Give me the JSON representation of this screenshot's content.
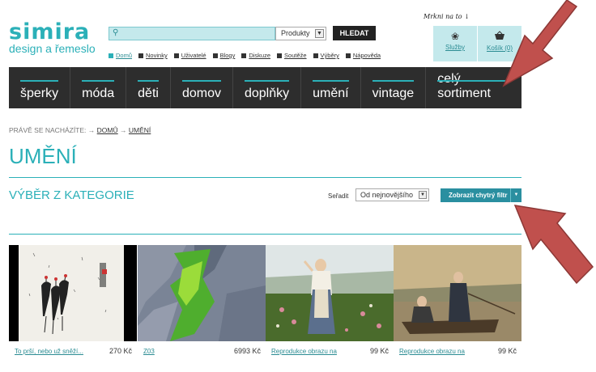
{
  "logo": {
    "brand": "simira",
    "tagline": "design a řemeslo"
  },
  "search": {
    "placeholder": "",
    "value": "",
    "category": "Produkty",
    "button": "HLEDAT"
  },
  "toplinks": [
    "Domů",
    "Novinky",
    "Uživatelé",
    "Blogy",
    "Diskuze",
    "Soutěže",
    "Výběry",
    "Nápověda"
  ],
  "note": "Mrkni na to ↓",
  "services": {
    "sluzby": "Služby",
    "kosik": "Košík (0)"
  },
  "nav": [
    "šperky",
    "móda",
    "děti",
    "domov",
    "doplňky",
    "umění",
    "vintage",
    "celý sortiment"
  ],
  "breadcrumb": {
    "prefix": "PRÁVĚ SE NACHÁZÍTE:",
    "sep": "→",
    "home": "DOMŮ",
    "current": "UMĚNÍ"
  },
  "page_title": "UMĚNÍ",
  "subtitle": "VÝBĚR Z KATEGORIE",
  "sort": {
    "label": "Seřadit",
    "value": "Od nejnovějšího"
  },
  "filter_button": "Zobrazit chytrý filtr",
  "products": [
    {
      "name": "To prší, nebo už sněží...",
      "price": "270 Kč"
    },
    {
      "name": "Z03",
      "price": "6993 Kč"
    },
    {
      "name": "Reprodukce obrazu na",
      "price": "99 Kč"
    },
    {
      "name": "Reprodukce obrazu na",
      "price": "99 Kč"
    }
  ],
  "colors": {
    "accent": "#2bb0b8",
    "nav_bg": "#2d2d2d",
    "arrow": "#c0504d"
  }
}
